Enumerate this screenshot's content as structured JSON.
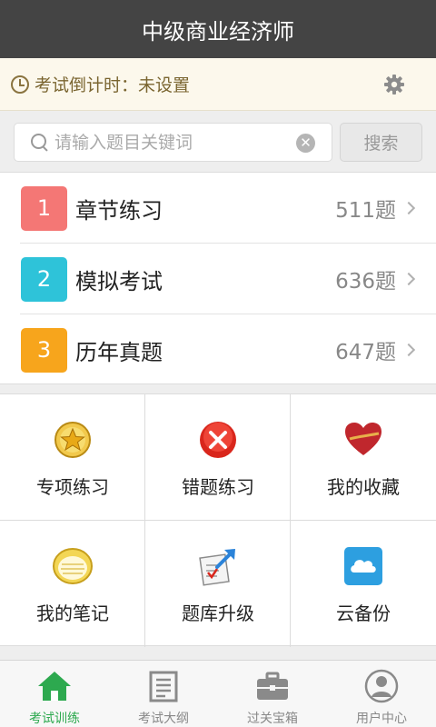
{
  "app": {
    "title": "中级商业经济师"
  },
  "countdown": {
    "label": "考试倒计时：",
    "value": "未设置",
    "settings_icon": "gear-icon"
  },
  "search": {
    "placeholder": "请输入题目关键词",
    "value": "",
    "button_label": "搜索"
  },
  "sections": [
    {
      "index": "1",
      "title": "章节练习",
      "count": "511题",
      "color": "#f47775"
    },
    {
      "index": "2",
      "title": "模拟考试",
      "count": "636题",
      "color": "#2ec3d9"
    },
    {
      "index": "3",
      "title": "历年真题",
      "count": "647题",
      "color": "#f7a51c"
    }
  ],
  "features": [
    {
      "label": "专项练习",
      "icon": "star-medal-icon"
    },
    {
      "label": "错题练习",
      "icon": "red-x-icon"
    },
    {
      "label": "我的收藏",
      "icon": "heart-icon"
    },
    {
      "label": "我的笔记",
      "icon": "notepad-icon"
    },
    {
      "label": "题库升级",
      "icon": "upgrade-arrow-icon"
    },
    {
      "label": "云备份",
      "icon": "cloud-icon"
    }
  ],
  "tabs": [
    {
      "label": "考试训练",
      "icon": "home-icon",
      "active": true
    },
    {
      "label": "考试大纲",
      "icon": "outline-doc-icon",
      "active": false
    },
    {
      "label": "过关宝箱",
      "icon": "briefcase-icon",
      "active": false
    },
    {
      "label": "用户中心",
      "icon": "user-icon",
      "active": false
    }
  ],
  "colors": {
    "titlebar": "#444444",
    "active_tab": "#2da94f"
  }
}
